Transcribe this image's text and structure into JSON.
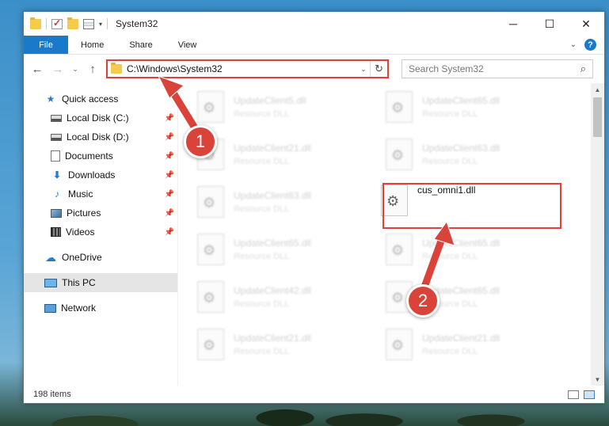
{
  "window": {
    "title": "System32",
    "controls": {
      "minimize": "─",
      "maximize": "☐",
      "close": "✕"
    }
  },
  "ribbon": {
    "tabs": [
      "File",
      "Home",
      "Share",
      "View"
    ],
    "help": "?"
  },
  "nav": {
    "back": "←",
    "forward": "→",
    "recent": "⌄",
    "up": "↑",
    "address": "C:\\Windows\\System32",
    "refresh": "↻",
    "search_placeholder": "Search System32",
    "search_icon": "⌕"
  },
  "sidebar": {
    "items": [
      {
        "label": "Quick access",
        "icon": "star-icon",
        "pinned": false
      },
      {
        "label": "Local Disk (C:)",
        "icon": "disk-icon",
        "pinned": true
      },
      {
        "label": "Local Disk (D:)",
        "icon": "disk-icon",
        "pinned": true
      },
      {
        "label": "Documents",
        "icon": "documents-icon",
        "pinned": true
      },
      {
        "label": "Downloads",
        "icon": "download-icon",
        "pinned": true
      },
      {
        "label": "Music",
        "icon": "music-icon",
        "pinned": true
      },
      {
        "label": "Pictures",
        "icon": "pictures-icon",
        "pinned": true
      },
      {
        "label": "Videos",
        "icon": "videos-icon",
        "pinned": true
      },
      {
        "label": "OneDrive",
        "icon": "cloud-icon",
        "pinned": false
      },
      {
        "label": "This PC",
        "icon": "computer-icon",
        "pinned": false,
        "selected": true
      },
      {
        "label": "Network",
        "icon": "network-icon",
        "pinned": false
      }
    ]
  },
  "files": {
    "left": [
      {
        "name": "UpdateClient5.dll",
        "type": "Resource DLL"
      },
      {
        "name": "UpdateClient21.dll",
        "type": "Resource DLL"
      },
      {
        "name": "UpdateClient63.dll",
        "type": "Resource DLL"
      },
      {
        "name": "UpdateClient65.dll",
        "type": "Resource DLL"
      },
      {
        "name": "UpdateClient42.dll",
        "type": "Resource DLL"
      },
      {
        "name": "UpdateClient21.dll",
        "type": "Resource DLL"
      }
    ],
    "right": [
      {
        "name": "UpdateClient65.dll",
        "type": "Resource DLL"
      },
      {
        "name": "UpdateClient63.dll",
        "type": "Resource DLL"
      },
      {
        "name": "cus_omni1.dll",
        "type": "",
        "focused": true
      },
      {
        "name": "UpdateClient65.dll",
        "type": "Resource DLL"
      },
      {
        "name": "UpdateClient65.dll",
        "type": "Resource DLL"
      },
      {
        "name": "UpdateClient21.dll",
        "type": "Resource DLL"
      }
    ]
  },
  "status": {
    "item_count": "198 items"
  },
  "callouts": {
    "one": "1",
    "two": "2"
  },
  "colors": {
    "accent": "#1979ca",
    "highlight": "#e0403a",
    "callout": "#d9433a"
  }
}
